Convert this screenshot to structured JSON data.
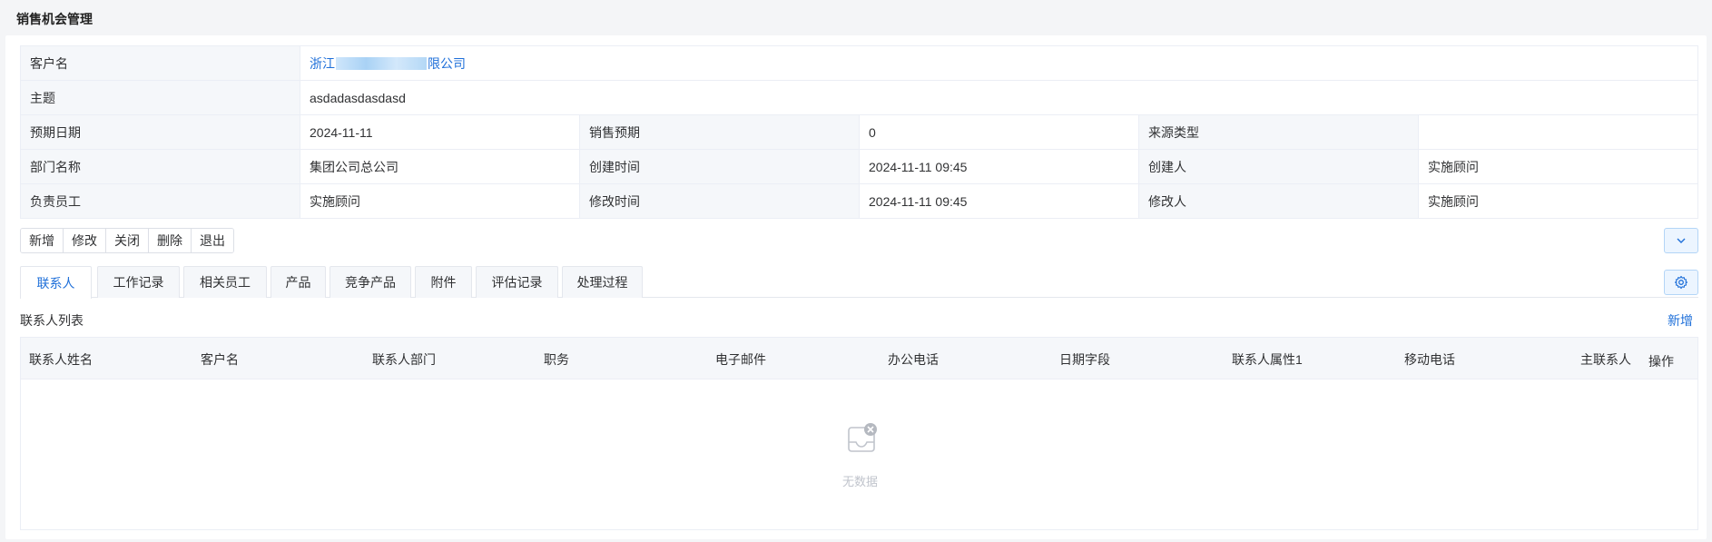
{
  "page": {
    "title": "销售机会管理"
  },
  "info": {
    "customer_label": "客户名",
    "customer_prefix": "浙江",
    "customer_suffix": "限公司",
    "subject_label": "主题",
    "subject_value": "asdadasdasdasd",
    "expect_date_label": "预期日期",
    "expect_date_value": "2024-11-11",
    "sales_expect_label": "销售预期",
    "sales_expect_value": "0",
    "source_type_label": "来源类型",
    "source_type_value": "",
    "dept_label": "部门名称",
    "dept_value": "集团公司总公司",
    "created_time_label": "创建时间",
    "created_time_value": "2024-11-11 09:45",
    "creator_label": "创建人",
    "creator_value": "实施顾问",
    "owner_label": "负责员工",
    "owner_value": "实施顾问",
    "modified_time_label": "修改时间",
    "modified_time_value": "2024-11-11 09:45",
    "modifier_label": "修改人",
    "modifier_value": "实施顾问"
  },
  "actions": [
    "新增",
    "修改",
    "关闭",
    "删除",
    "退出"
  ],
  "tabs": [
    "联系人",
    "工作记录",
    "相关员工",
    "产品",
    "竞争产品",
    "附件",
    "评估记录",
    "处理过程"
  ],
  "contacts": {
    "title": "联系人列表",
    "add_label": "新增",
    "columns": [
      "联系人姓名",
      "客户名",
      "联系人部门",
      "职务",
      "电子邮件",
      "办公电话",
      "日期字段",
      "联系人属性1",
      "移动电话",
      "主联系人",
      "操作"
    ],
    "empty_text": "无数据"
  },
  "icons": {
    "collapse": "chevron-down-icon",
    "settings": "gear-icon",
    "empty": "empty-inbox-icon"
  },
  "colors": {
    "accent": "#1e6fd9",
    "header_bg": "#f5f7fa"
  }
}
